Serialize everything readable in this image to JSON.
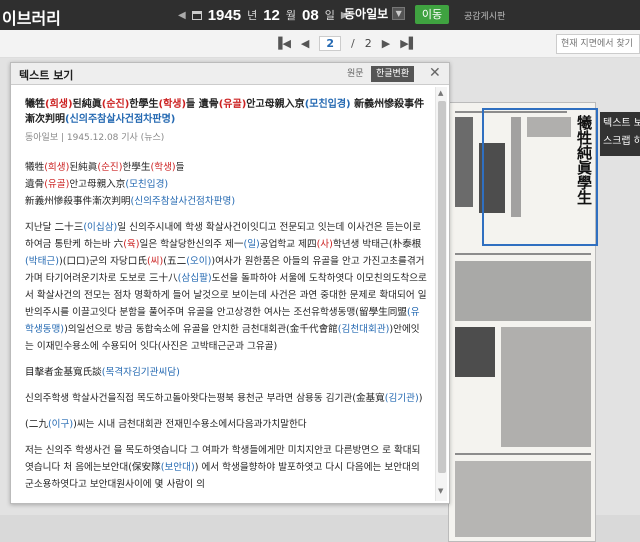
{
  "topbar": {
    "brand": "이브러리",
    "year": "1945",
    "year_unit": "년",
    "month": "12",
    "month_unit": "월",
    "day": "08",
    "day_unit": "일",
    "paper": "동아일보",
    "go_label": "이동",
    "notice_label": "공감게시판"
  },
  "pagebar": {
    "current_page": "2",
    "separator": "/",
    "total_pages": "2",
    "search_placeholder": "현재 지면에서 찾기"
  },
  "text_panel": {
    "title": "텍스트 보기",
    "tab_original": "원문",
    "tab_converted": "한글변환",
    "close": "✕",
    "article": {
      "title_parts": [
        {
          "t": "犧牲",
          "c": ""
        },
        {
          "t": "(희생)",
          "c": "red"
        },
        {
          "t": "된純眞",
          "c": ""
        },
        {
          "t": "(순진)",
          "c": "red"
        },
        {
          "t": "한學生",
          "c": ""
        },
        {
          "t": "(학생)",
          "c": "red"
        },
        {
          "t": "들  遺骨",
          "c": ""
        },
        {
          "t": "(유골)",
          "c": "red"
        },
        {
          "t": "안고母親入京",
          "c": ""
        },
        {
          "t": "(모친입경)",
          "c": "blue"
        },
        {
          "t": " 新義州慘殺事件漸次判明",
          "c": ""
        },
        {
          "t": "(신의주참살사건점차판명)",
          "c": "blue"
        }
      ],
      "meta": "동아일보 | 1945.12.08 기사 (뉴스)",
      "sub_lines": [
        [
          {
            "t": "犧牲",
            "c": ""
          },
          {
            "t": "(희생)",
            "c": "red"
          },
          {
            "t": "된純眞",
            "c": ""
          },
          {
            "t": "(순진)",
            "c": "red"
          },
          {
            "t": "한學生",
            "c": ""
          },
          {
            "t": "(학생)",
            "c": "red"
          },
          {
            "t": "들",
            "c": ""
          }
        ],
        [
          {
            "t": "遺骨",
            "c": ""
          },
          {
            "t": "(유골)",
            "c": "red"
          },
          {
            "t": "안고母親入京",
            "c": ""
          },
          {
            "t": "(모친입경)",
            "c": "blue"
          }
        ],
        [
          {
            "t": "新義州慘殺事件漸次判明",
            "c": ""
          },
          {
            "t": "(신의주참살사건점차판명)",
            "c": "blue"
          }
        ]
      ],
      "body_paras": [
        [
          {
            "t": "  지난달 二十三",
            "c": ""
          },
          {
            "t": "(이십삼)",
            "c": "blue"
          },
          {
            "t": "일 신의주시내에 학생 확살사건이잇디고 전문되고 잇는데 이사건은 듣는이로하여금 통탄케 하는바 六",
            "c": ""
          },
          {
            "t": "(육)",
            "c": "red"
          },
          {
            "t": "일은 학살당한신의주 제一",
            "c": ""
          },
          {
            "t": "(일)",
            "c": "blue"
          },
          {
            "t": "공업학교 제四",
            "c": ""
          },
          {
            "t": "(사)",
            "c": "red"
          },
          {
            "t": "학년생 박태근(朴泰根",
            "c": ""
          },
          {
            "t": "(박태근)",
            "c": "blue"
          },
          {
            "t": ")(口口)군의 자당口氏",
            "c": ""
          },
          {
            "t": "(씨)",
            "c": "red"
          },
          {
            "t": "(五二",
            "c": ""
          },
          {
            "t": "(오이)",
            "c": "blue"
          },
          {
            "t": ")여사가 원한품은 아들의 유골을 안고 가진고초를겪거가며 타기어려운기차로 도보로 三十八",
            "c": ""
          },
          {
            "t": "(삼십팔)",
            "c": "blue"
          },
          {
            "t": "도선을 돌파하야 서울에 도착하엿다 이모친의도착으로서 확살사건의 전모는 점차 명확하게 들어 날것으로 보이는데 사건은 과연 중대한 문제로 확대되어 일반의주시를 이끌고잇다 분함을 풀어주며 유골을 안고상경한 여사는 조선유학생동맹(留學生同盟",
            "c": ""
          },
          {
            "t": "(유학생동맹)",
            "c": "blue"
          },
          {
            "t": ")의일선으로 방금 동합숙소에 유골을 안치한 금천대회관(金千代會館",
            "c": ""
          },
          {
            "t": "(김천대회관)",
            "c": "blue"
          },
          {
            "t": ")안에잇는 이재민수용소에 수용되어 잇다(사진은 고박태근군과 그유골)",
            "c": ""
          }
        ],
        [
          {
            "t": "目擊者金基寬氏談",
            "c": ""
          },
          {
            "t": "(목격자김기관씨담)",
            "c": "blue"
          }
        ],
        [
          {
            "t": "신의주학생 학살사건을직접 목도하고돌아왓다는평북 용천군 부라면 삼용동 김기관(金基寬",
            "c": ""
          },
          {
            "t": "(김기관)",
            "c": "blue"
          },
          {
            "t": ")",
            "c": ""
          }
        ],
        [
          {
            "t": "(二九",
            "c": ""
          },
          {
            "t": "(이구)",
            "c": "blue"
          },
          {
            "t": ")씨는 시내 금천대회관 전재민수용소에서다음과가치말한다",
            "c": ""
          }
        ],
        [
          {
            "t": "  저는 신의주 학생사건 을 목도하엿습니다 그 여파가 학생들에게만 미치지안코 다른방면으 로 확대되엿습니다 처 음에는보안대(保安隊",
            "c": ""
          },
          {
            "t": "(보안대)",
            "c": "blue"
          },
          {
            "t": ") 에서 학생을향하야 발포하엿고 다시 다음에는 보안대의 군소용하엿다고 보안대원사이에 몇 사람이 의",
            "c": ""
          }
        ]
      ]
    }
  },
  "newspaper": {
    "headline": "犧牲純眞學生",
    "tooltip_line1": "텍스트 보기",
    "tooltip_line2": "스크랩 하기"
  },
  "colors": {
    "topbar_bg": "#2f2f2f",
    "go_button": "#3fa240",
    "hanja_reading_red": "#c22222",
    "hanja_reading_blue": "#2469b2",
    "highlight_border": "#2f6fc0"
  },
  "icons": [
    "calendar-icon",
    "prev-arrow-icon",
    "next-arrow-icon",
    "dropdown-icon",
    "first-page-icon",
    "prev-page-icon",
    "next-page-icon",
    "last-page-icon",
    "close-icon",
    "scroll-up-icon",
    "scroll-down-icon"
  ]
}
